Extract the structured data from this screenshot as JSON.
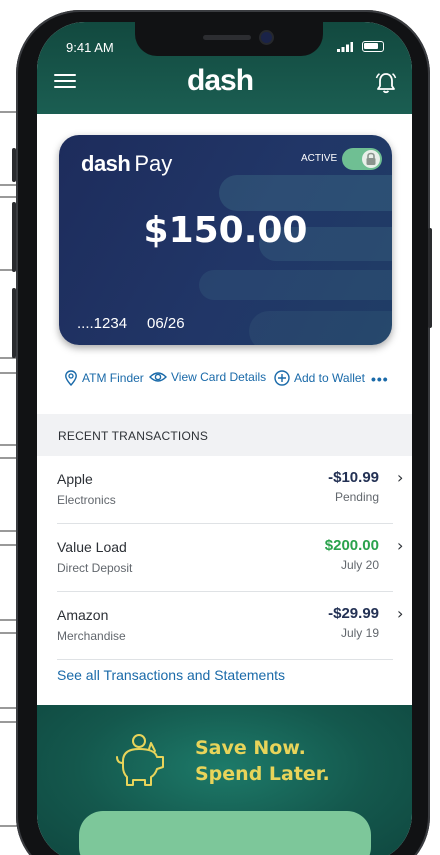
{
  "status_bar": {
    "time": "9:41 AM"
  },
  "header": {
    "logo": "dash"
  },
  "card": {
    "brand_bold": "dash",
    "brand_light": "Pay",
    "status": "ACTIVE",
    "active": true,
    "balance": "$150.00",
    "number": "....1234",
    "expiry": "06/26"
  },
  "actions": {
    "atm_finder": "ATM Finder",
    "view_card_details": "View Card Details",
    "add_to_wallet": "Add to Wallet",
    "more": "•••"
  },
  "transactions": {
    "heading": "RECENT TRANSACTIONS",
    "items": [
      {
        "name": "Apple",
        "category": "Electronics",
        "amount": "-$10.99",
        "status": "Pending"
      },
      {
        "name": "Value Load",
        "category": "Direct Deposit",
        "amount": "$200.00",
        "status": "July 20"
      },
      {
        "name": "Amazon",
        "category": "Merchandise",
        "amount": "-$29.99",
        "status": "July 19"
      }
    ],
    "see_all": "See all Transactions and Statements"
  },
  "promo": {
    "line1": "Save Now.",
    "line2": "Spend Later."
  },
  "colors": {
    "header": "#1b5e52",
    "card": "#213667",
    "link": "#1a6aa9",
    "positive_amount": "#2aa24c",
    "promo_text": "#e8d45a",
    "toggle": "#6fbf93"
  },
  "icons": [
    "menu-icon",
    "bell-icon",
    "lock-icon",
    "location-pin-icon",
    "eye-icon",
    "plus-circle-icon",
    "chevron-right-icon",
    "piggy-bank-icon"
  ]
}
